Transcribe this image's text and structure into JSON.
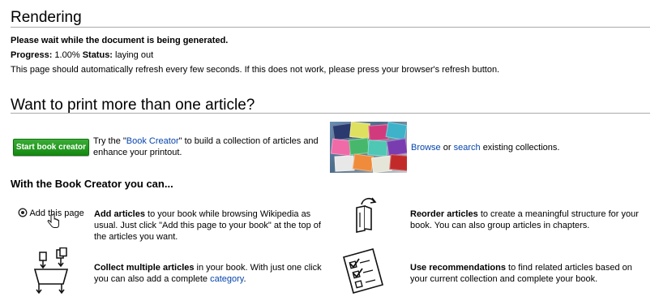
{
  "rendering": {
    "title": "Rendering",
    "wait_message": "Please wait while the document is being generated.",
    "progress_label": "Progress:",
    "progress_value": "1.00%",
    "status_label": "Status:",
    "status_value": "laying out",
    "refresh_note": "This page should automatically refresh every few seconds. If this does not work, please press your browser's refresh button."
  },
  "print_more": {
    "title": "Want to print more than one article?",
    "button_label": "Start book creator",
    "promo_prefix": "Try the \"",
    "promo_link": "Book Creator",
    "promo_suffix": "\" to build a collection of articles and enhance your printout.",
    "browse_link": "Browse",
    "or_text": "or",
    "search_link": "search",
    "collections_text": "existing collections."
  },
  "features": {
    "heading": "With the Book Creator you can...",
    "add_page_badge": "Add this page",
    "add_articles_bold": "Add articles",
    "add_articles_text": "to your book while browsing Wikipedia as usual. Just click \"Add this page to your book\" at the top of the articles you want.",
    "reorder_bold": "Reorder articles",
    "reorder_text": "to create a meaningful structure for your book. You can also group articles in chapters.",
    "collect_bold": "Collect multiple articles",
    "collect_text": "in your book. With just one click you can also add a complete",
    "category_link": "category",
    "collect_end": ".",
    "recommend_bold": "Use recommendations",
    "recommend_text": "to find related articles based on your current collection and complete your book."
  },
  "colors": {
    "link": "#0645ad",
    "button_green": "#1a9516",
    "rule_gray": "#aaaaaa"
  },
  "icons": [
    "add-page-icon",
    "hand-cursor-icon",
    "reorder-pages-icon",
    "collect-articles-icon",
    "checklist-icon"
  ]
}
